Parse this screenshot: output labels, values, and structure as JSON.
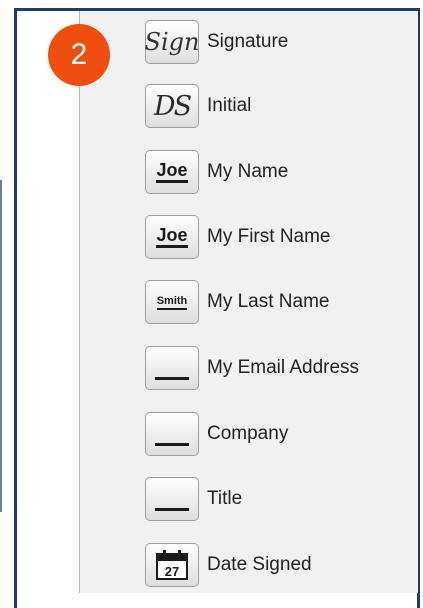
{
  "step_number": "2",
  "icons": {
    "sign": "Sign",
    "initial": "DS",
    "joe": "Joe",
    "smith": "Smith",
    "calendar_day": "27"
  },
  "fields": [
    {
      "label": "Signature",
      "icon": "signature-icon"
    },
    {
      "label": "Initial",
      "icon": "initial-icon"
    },
    {
      "label": "My Name",
      "icon": "name-icon"
    },
    {
      "label": "My First Name",
      "icon": "first-name-icon"
    },
    {
      "label": "My Last Name",
      "icon": "last-name-icon"
    },
    {
      "label": "My Email Address",
      "icon": "blank-line-icon"
    },
    {
      "label": "Company",
      "icon": "blank-line-icon"
    },
    {
      "label": "Title",
      "icon": "blank-line-icon"
    },
    {
      "label": "Date Signed",
      "icon": "calendar-icon"
    }
  ],
  "colors": {
    "badge": "#f04e0f",
    "frame": "#1e3b6e",
    "panel": "#f1f1f1"
  }
}
